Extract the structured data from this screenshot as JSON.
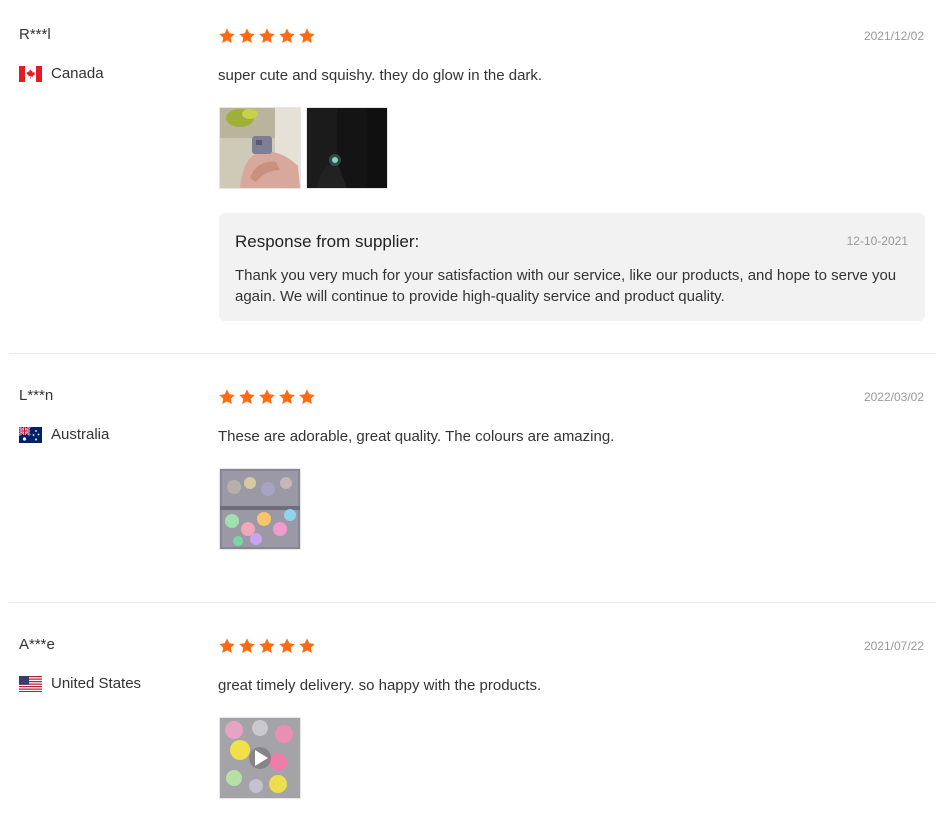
{
  "colors": {
    "star": "#ff6a13",
    "text": "#333333",
    "muted": "#999999",
    "response_bg": "#f2f2f2"
  },
  "reviews": [
    {
      "reviewer": "R***l",
      "country": "Canada",
      "flag_icon": "canada-flag-icon",
      "rating": 5,
      "date": "2021/12/02",
      "text": "super cute and squishy. they do glow in the dark.",
      "photos": [
        "review-photo-hand-holding-cube",
        "review-photo-glow-in-dark"
      ],
      "response": {
        "title": "Response from supplier:",
        "date": "12-10-2021",
        "text": "Thank you very much for your satisfaction with our service, like our products, and hope to serve you again. We will continue to provide high-quality service and product quality."
      }
    },
    {
      "reviewer": "L***n",
      "country": "Australia",
      "flag_icon": "australia-flag-icon",
      "rating": 5,
      "date": "2022/03/02",
      "text": "These are adorable, great quality. The colours are amazing.",
      "photos": [
        "review-photo-colorful-bag"
      ]
    },
    {
      "reviewer": "A***e",
      "country": "United States",
      "flag_icon": "usa-flag-icon",
      "rating": 5,
      "date": "2021/07/22",
      "text": "great timely delivery. so happy with the products.",
      "photos": [
        "review-video-thumbnail"
      ]
    }
  ]
}
